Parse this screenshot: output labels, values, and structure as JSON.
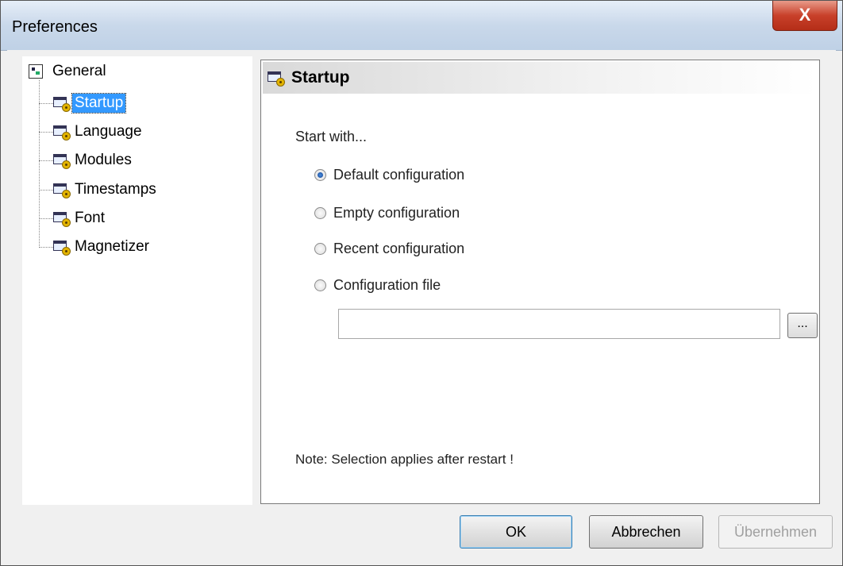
{
  "window": {
    "title": "Preferences",
    "close_label": "X"
  },
  "tree": {
    "root": "General",
    "items": [
      {
        "label": "Startup",
        "selected": true
      },
      {
        "label": "Language",
        "selected": false
      },
      {
        "label": "Modules",
        "selected": false
      },
      {
        "label": "Timestamps",
        "selected": false
      },
      {
        "label": "Font",
        "selected": false
      },
      {
        "label": "Magnetizer",
        "selected": false
      }
    ]
  },
  "panel": {
    "title": "Startup",
    "start_label": "Start with...",
    "options": [
      {
        "label": "Default configuration",
        "checked": true
      },
      {
        "label": "Empty configuration",
        "checked": false
      },
      {
        "label": "Recent configuration",
        "checked": false
      },
      {
        "label": "Configuration file",
        "checked": false
      }
    ],
    "file_value": "",
    "browse_label": "...",
    "note": "Note: Selection applies after restart !"
  },
  "buttons": {
    "ok": "OK",
    "cancel": "Abbrechen",
    "apply": "Übernehmen"
  },
  "icons": [
    "window-gear-icon",
    "tree-root-icon",
    "close-icon"
  ]
}
